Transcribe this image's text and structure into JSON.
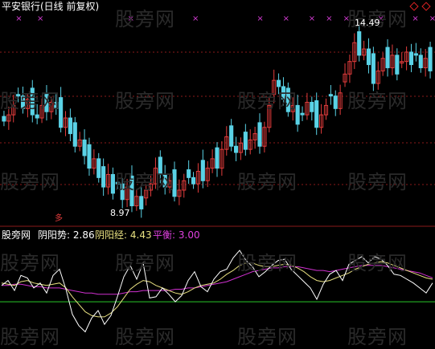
{
  "header": {
    "title": "平安银行(日线 前复权)"
  },
  "price_panel": {
    "high_label": "14.49",
    "low_label": "8.97",
    "signal_char": "多"
  },
  "indicator_panel": {
    "source": "股旁网",
    "items": [
      {
        "label": "阴阳势:",
        "value": "2.86",
        "color": "#ffffff"
      },
      {
        "label": "阴阳经:",
        "value": "4.43",
        "color": "#e8e080"
      },
      {
        "label": "平衡:",
        "value": "3.00",
        "color": "#e040e0"
      }
    ]
  },
  "watermark": "股旁网",
  "colors": {
    "up": "#e23c3c",
    "down": "#5ad2e6",
    "grid": "#8b1a1a",
    "line_white": "#ffffff",
    "line_yellow": "#e8e080",
    "line_magenta": "#d030d0",
    "baseline": "#29c829",
    "marker": "#d63cd6"
  },
  "chart_data": {
    "type": "candlestick",
    "price_range": [
      8.5,
      15.2
    ],
    "indicator_range": [
      -1.5,
      6.5
    ],
    "closes": [
      11.8,
      12.0,
      12.3,
      12.6,
      12.2,
      12.5,
      12.0,
      11.9,
      12.3,
      12.1,
      12.4,
      12.2,
      11.6,
      11.9,
      11.4,
      11.0,
      11.2,
      10.7,
      10.3,
      10.6,
      10.0,
      9.7,
      10.1,
      9.5,
      9.8,
      9.3,
      9.7,
      9.1,
      9.4,
      9.0,
      9.6,
      9.8,
      10.3,
      10.1,
      9.7,
      9.9,
      9.4,
      9.6,
      9.9,
      10.0,
      9.8,
      10.2,
      9.9,
      10.3,
      10.6,
      10.3,
      10.9,
      11.3,
      11.0,
      10.8,
      11.1,
      10.9,
      11.2,
      11.4,
      11.0,
      11.6,
      12.3,
      13.1,
      12.9,
      12.5,
      12.1,
      12.3,
      11.7,
      12.0,
      12.4,
      12.1,
      11.6,
      12.0,
      12.3,
      12.6,
      12.2,
      12.7,
      13.3,
      13.7,
      14.3,
      13.9,
      14.1,
      13.6,
      13.0,
      13.4,
      13.8,
      13.5,
      13.9,
      13.3,
      13.7,
      14.0,
      13.6,
      13.9,
      13.5,
      13.8,
      13.4
    ],
    "indicator": {
      "white": [
        2.8,
        3.2,
        2.4,
        3.6,
        3.4,
        2.6,
        3.0,
        2.2,
        3.6,
        4.1,
        2.5,
        0.5,
        -0.4,
        -0.9,
        0.2,
        0.8,
        -0.3,
        0.4,
        1.9,
        3.5,
        4.4,
        3.3,
        4.6,
        1.8,
        1.9,
        2.6,
        2.1,
        1.5,
        2.0,
        3.2,
        3.9,
        2.7,
        2.3,
        3.3,
        3.9,
        4.1,
        5.0,
        5.6,
        4.8,
        4.3,
        3.5,
        3.9,
        4.4,
        4.8,
        4.9,
        4.1,
        3.6,
        3.1,
        2.6,
        1.7,
        2.9,
        3.7,
        4.0,
        3.2,
        4.5,
        4.8,
        5.1,
        4.6,
        5.1,
        4.9,
        4.4,
        3.7,
        3.6,
        3.3,
        3.0,
        2.6,
        2.2,
        3.0
      ],
      "yellow": [
        3.0,
        2.9,
        2.8,
        3.1,
        3.2,
        3.0,
        2.9,
        2.8,
        2.9,
        3.0,
        2.6,
        1.9,
        1.3,
        0.7,
        0.4,
        0.3,
        0.3,
        0.6,
        1.1,
        1.8,
        2.5,
        2.9,
        3.2,
        3.1,
        2.8,
        2.6,
        2.4,
        2.2,
        2.1,
        2.3,
        2.6,
        2.8,
        2.9,
        3.0,
        3.3,
        3.7,
        4.0,
        4.4,
        4.6,
        4.6,
        4.4,
        4.3,
        4.3,
        4.4,
        4.5,
        4.4,
        4.2,
        3.9,
        3.5,
        3.2,
        3.1,
        3.2,
        3.4,
        3.6,
        3.8,
        4.1,
        4.3,
        4.5,
        4.6,
        4.7,
        4.6,
        4.4,
        4.2,
        4.0,
        3.8,
        3.6,
        3.4,
        3.3
      ],
      "magenta": [
        2.8,
        2.8,
        2.9,
        2.9,
        2.8,
        2.7,
        2.7,
        2.6,
        2.6,
        2.6,
        2.5,
        2.4,
        2.3,
        2.2,
        2.2,
        2.1,
        2.1,
        2.1,
        2.1,
        2.2,
        2.3,
        2.3,
        2.4,
        2.4,
        2.4,
        2.4,
        2.4,
        2.5,
        2.5,
        2.6,
        2.6,
        2.7,
        2.8,
        2.9,
        3.0,
        3.1,
        3.3,
        3.5,
        3.7,
        3.9,
        4.0,
        4.1,
        4.2,
        4.2,
        4.3,
        4.3,
        4.3,
        4.2,
        4.1,
        4.0,
        4.0,
        3.9,
        4.0,
        4.1,
        4.2,
        4.3,
        4.4,
        4.4,
        4.4,
        4.4,
        4.3,
        4.2,
        4.1,
        4.0,
        3.9,
        3.8,
        3.6,
        3.4
      ],
      "baseline": 1.5
    }
  }
}
